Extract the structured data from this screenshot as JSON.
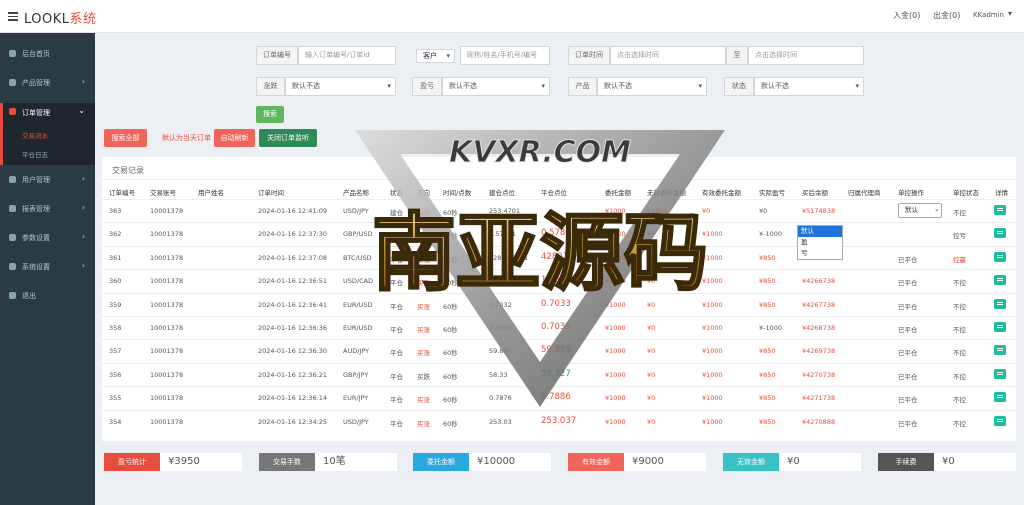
{
  "header": {
    "brand_main": "LOOKL",
    "brand_accent": "系统",
    "deposit": "入金(0)",
    "withdraw": "出金(0)",
    "user": "KKadmin"
  },
  "sidebar": {
    "items": [
      {
        "label": "后台首页",
        "icon": "home-icon",
        "arrow": ""
      },
      {
        "label": "产品管理",
        "icon": "box-icon",
        "arrow": "›"
      },
      {
        "label": "订单管理",
        "icon": "list-icon",
        "arrow": "⌄"
      },
      {
        "label": "用户管理",
        "icon": "user-icon",
        "arrow": "›"
      },
      {
        "label": "报表管理",
        "icon": "chart-icon",
        "arrow": "›"
      },
      {
        "label": "参数设置",
        "icon": "settings-icon",
        "arrow": "›"
      },
      {
        "label": "系统设置",
        "icon": "gear-icon",
        "arrow": "›"
      },
      {
        "label": "退出",
        "icon": "logout-icon",
        "arrow": ""
      }
    ],
    "sub": [
      {
        "label": "交易流水"
      },
      {
        "label": "平仓日志"
      }
    ]
  },
  "filters": {
    "order_label": "订单编号",
    "order_ph": "输入订单编号/订单id",
    "customer_select": "客户",
    "customer_ph": "昵称/姓名/手机号/编号",
    "time_label": "订单时间",
    "time_ph": "点击选择时间",
    "to_label": "至",
    "time2_ph": "点击选择时间",
    "direction_label": "涨跌",
    "direction_val": "默认不选",
    "pnl_label": "盈亏",
    "pnl_val": "默认不选",
    "product_label": "产品",
    "product_val": "默认不选",
    "status_label": "状态",
    "status_val": "默认不选",
    "search_btn": "搜索"
  },
  "actions": {
    "search_all": "搜索全部",
    "today_note": "默认为当天订单",
    "auto_refresh": "自动刷新",
    "close_monitor": "关闭订单监听"
  },
  "panel": {
    "title": "交易记录"
  },
  "table": {
    "headers": [
      "订单编号",
      "交易账号",
      "用户姓名",
      "订单时间",
      "产品名称",
      "状态",
      "方向",
      "时间/点数",
      "建仓点位",
      "平仓点位",
      "委托金额",
      "无效委托金额",
      "有效委托金额",
      "实际盈亏",
      "买后余额",
      "归属代理商",
      "单控操作",
      "单控状态",
      "详情"
    ],
    "rows": [
      {
        "id": "363",
        "acct": "10001378",
        "time": "2024-01-16 12:41:09",
        "product": "USD/JPY",
        "status": "建仓",
        "dir": "买涨",
        "period": "60秒",
        "open": "253.4701",
        "close": "",
        "amount": "¥1000",
        "invalid": "¥1000",
        "valid": "¥0",
        "pnl": "¥0",
        "balance": "¥5174838",
        "ctrl": "默认",
        "cstate": "不控"
      },
      {
        "id": "362",
        "acct": "10001378",
        "time": "2024-01-16 12:37:30",
        "product": "GBP/USD",
        "status": "平仓",
        "dir": "买涨",
        "period": "60秒",
        "open": "0.57871",
        "close": "0.57881",
        "amount": "¥1000",
        "invalid": "¥0",
        "valid": "¥1000",
        "pnl": "¥-1000",
        "balance": "¥4264738",
        "ctrl": "",
        "cstate": "控亏"
      },
      {
        "id": "361",
        "acct": "10001378",
        "time": "2024-01-16 12:37:08",
        "product": "BTC/USD",
        "status": "平仓",
        "dir": "买涨",
        "period": "60秒",
        "open": "42807.2901",
        "close": "42807.2911",
        "amount": "¥1000",
        "invalid": "¥0",
        "valid": "¥1000",
        "pnl": "¥850",
        "balance": "¥4265738",
        "ctrl": "已平仓",
        "cstate": "控赢"
      },
      {
        "id": "360",
        "acct": "10001378",
        "time": "2024-01-16 12:36:51",
        "product": "USD/CAD",
        "status": "平仓",
        "dir": "买涨",
        "period": "60秒",
        "open": "1.0598",
        "close": "1.0599",
        "amount": "¥1000",
        "invalid": "¥0",
        "valid": "¥1000",
        "pnl": "¥850",
        "balance": "¥4266738",
        "ctrl": "已平仓",
        "cstate": "不控"
      },
      {
        "id": "359",
        "acct": "10001378",
        "time": "2024-01-16 12:36:41",
        "product": "EUR/USD",
        "status": "平仓",
        "dir": "买涨",
        "period": "60秒",
        "open": "0.7032",
        "close": "0.7033",
        "amount": "¥1000",
        "invalid": "¥0",
        "valid": "¥1000",
        "pnl": "¥850",
        "balance": "¥4267738",
        "ctrl": "已平仓",
        "cstate": "不控"
      },
      {
        "id": "358",
        "acct": "10001378",
        "time": "2024-01-16 12:36:36",
        "product": "EUR/USD",
        "status": "平仓",
        "dir": "买涨",
        "period": "60秒",
        "open": "0.7035",
        "close": "0.7039",
        "amount": "¥1000",
        "invalid": "¥0",
        "valid": "¥1000",
        "pnl": "¥-1000",
        "balance": "¥4268738",
        "ctrl": "已平仓",
        "cstate": "不控"
      },
      {
        "id": "357",
        "acct": "10001378",
        "time": "2024-01-16 12:36:30",
        "product": "AUD/JPY",
        "status": "平仓",
        "dir": "买涨",
        "period": "60秒",
        "open": "59.89",
        "close": "59.899",
        "amount": "¥1000",
        "invalid": "¥0",
        "valid": "¥1000",
        "pnl": "¥850",
        "balance": "¥4269738",
        "ctrl": "已平仓",
        "cstate": "不控"
      },
      {
        "id": "356",
        "acct": "10001378",
        "time": "2024-01-16 12:36:21",
        "product": "GBP/JPY",
        "status": "平仓",
        "dir": "买跌",
        "period": "60秒",
        "open": "58.33",
        "close": "58.327",
        "amount": "¥1000",
        "invalid": "¥0",
        "valid": "¥1000",
        "pnl": "¥850",
        "balance": "¥4270738",
        "ctrl": "已平仓",
        "cstate": "不控"
      },
      {
        "id": "355",
        "acct": "10001378",
        "time": "2024-01-16 12:36:14",
        "product": "EUR/JPY",
        "status": "平仓",
        "dir": "买涨",
        "period": "60秒",
        "open": "0.7876",
        "close": "0.7886",
        "amount": "¥1000",
        "invalid": "¥0",
        "valid": "¥1000",
        "pnl": "¥850",
        "balance": "¥4271738",
        "ctrl": "已平仓",
        "cstate": "不控"
      },
      {
        "id": "354",
        "acct": "10001378",
        "time": "2024-01-16 12:34:25",
        "product": "USD/JPY",
        "status": "平仓",
        "dir": "买涨",
        "period": "60秒",
        "open": "253.03",
        "close": "253.037",
        "amount": "¥1000",
        "invalid": "¥0",
        "valid": "¥1000",
        "pnl": "¥850",
        "balance": "¥4270888",
        "ctrl": "已平仓",
        "cstate": "不控"
      }
    ]
  },
  "dropdown": {
    "options": [
      "默认",
      "盈",
      "亏"
    ]
  },
  "stats": [
    {
      "label": "盈亏统计",
      "value": "¥3950",
      "color": "#e74c3c"
    },
    {
      "label": "交易手数",
      "value": "10笔",
      "color": "#777777"
    },
    {
      "label": "委托金额",
      "value": "¥10000",
      "color": "#29a9e1"
    },
    {
      "label": "有效金额",
      "value": "¥9000",
      "color": "#f0645a"
    },
    {
      "label": "无效金额",
      "value": "¥0",
      "color": "#36c3c3"
    },
    {
      "label": "手续费",
      "value": "¥0",
      "color": "#555555"
    }
  ],
  "watermark": {
    "top": "KVXR.COM",
    "main": "南亚源码"
  }
}
